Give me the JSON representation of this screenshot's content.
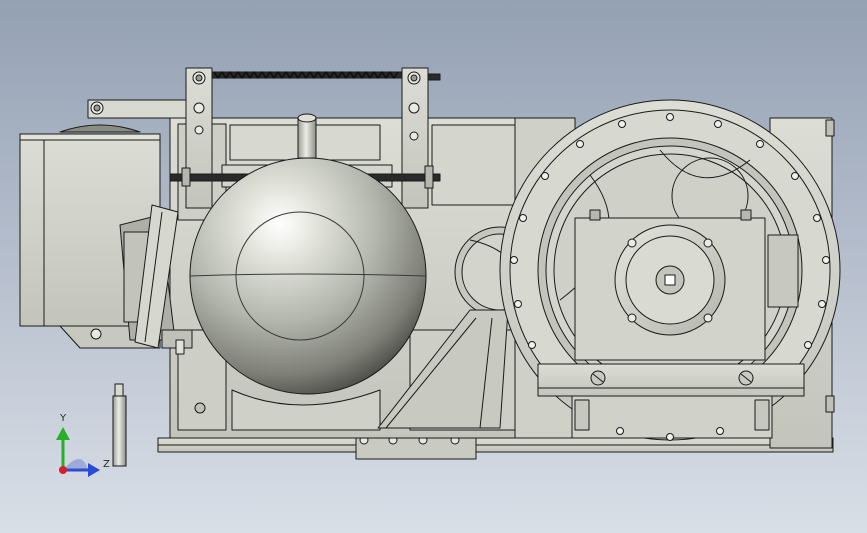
{
  "viewport": {
    "background_top": "#94a1b3",
    "background_bottom": "#d9dfe7",
    "part_fill": "#d1d3cc",
    "part_shade": "#b9bbb2",
    "edge_color": "#1a1a1a"
  },
  "model": {
    "components": [
      "motor-housing",
      "brake-drum",
      "gearbox-casing",
      "traction-sheave",
      "brake-arms",
      "tension-spring",
      "mounting-bracket",
      "base-frame"
    ]
  },
  "triad": {
    "y_label": "Y",
    "z_label": "Z",
    "y_color": "#27b027",
    "z_color": "#2a4ad8",
    "origin_color": "#d4202a"
  }
}
